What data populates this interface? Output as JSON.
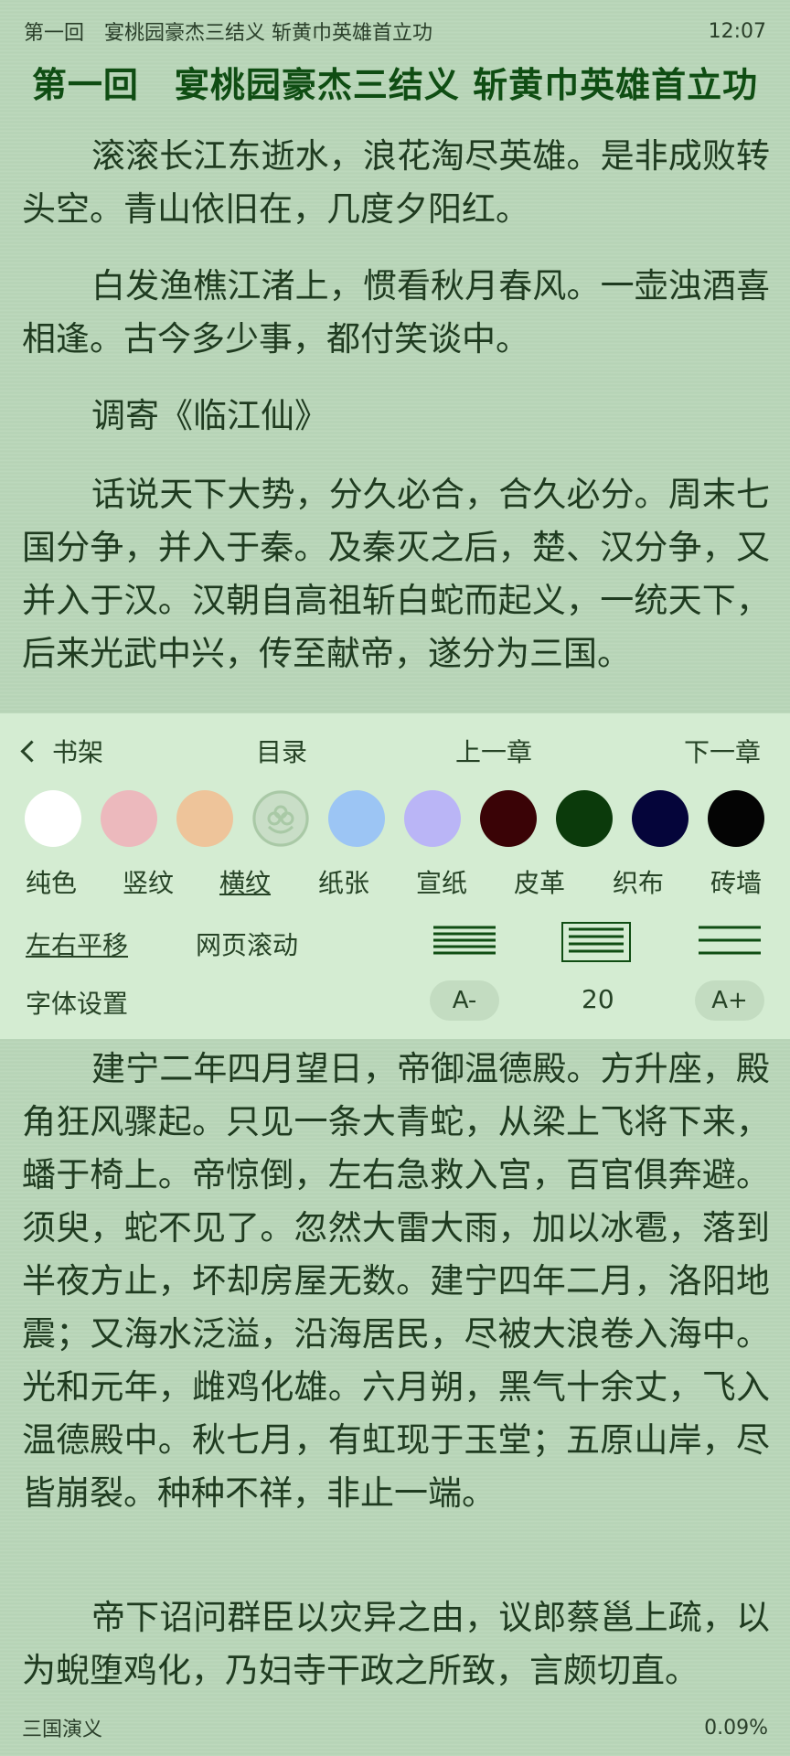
{
  "status_bar": {
    "chapter": "第一回　宴桃园豪杰三结义 斩黄巾英雄首立功",
    "time": "12:07"
  },
  "content": {
    "title": "第一回　宴桃园豪杰三结义 斩黄巾英雄首立功",
    "paragraphs_above": [
      "滚滚长江东逝水，浪花淘尽英雄。是非成败转头空。青山依旧在，几度夕阳红。",
      "白发渔樵江渚上，惯看秋月春风。一壶浊酒喜相逢。古今多少事，都付笑谈中。",
      "调寄《临江仙》",
      "话说天下大势，分久必合，合久必分。周末七国分争，并入于秦。及秦灭之后，楚、汉分争，又并入于汉。汉朝自高祖斩白蛇而起义，一统天下，后来光武中兴，传至献帝，遂分为三国。"
    ],
    "paragraphs_below": [
      "建宁二年四月望日，帝御温德殿。方升座，殿角狂风骤起。只见一条大青蛇，从梁上飞将下来，蟠于椅上。帝惊倒，左右急救入宫，百官俱奔避。须臾，蛇不见了。忽然大雷大雨，加以冰雹，落到半夜方止，坏却房屋无数。建宁四年二月，洛阳地震；又海水泛溢，沿海居民，尽被大浪卷入海中。光和元年，雌鸡化雄。六月朔，黑气十余丈，飞入温德殿中。秋七月，有虹现于玉堂；五原山岸，尽皆崩裂。种种不祥，非止一端。",
      "帝下诏问群臣以灾异之由，议郎蔡邕上疏，以为蜺堕鸡化，乃妇寺干政之所致，言颇切直。"
    ]
  },
  "panel": {
    "nav": {
      "back_label": "书架",
      "toc_label": "目录",
      "prev_label": "上一章",
      "next_label": "下一章"
    },
    "swatches": [
      {
        "name": "white",
        "color": "#ffffff"
      },
      {
        "name": "pink",
        "color": "#ecb9bd"
      },
      {
        "name": "peach",
        "color": "#eec49a"
      },
      {
        "name": "texture",
        "color": "#c9dec7"
      },
      {
        "name": "light-blue",
        "color": "#9cc5f4"
      },
      {
        "name": "lavender",
        "color": "#bab5f6"
      },
      {
        "name": "dark-red",
        "color": "#3a0306"
      },
      {
        "name": "dark-green",
        "color": "#0b3a0b"
      },
      {
        "name": "navy",
        "color": "#05053a"
      },
      {
        "name": "black",
        "color": "#040404"
      }
    ],
    "backgrounds": [
      "纯色",
      "竖纹",
      "横纹",
      "纸张",
      "宣纸",
      "皮革",
      "织布",
      "砖墙"
    ],
    "selected_background": "横纹",
    "page_modes": [
      "左右平移",
      "网页滚动"
    ],
    "selected_page_mode": "左右平移",
    "line_spacing_options": [
      "compact",
      "normal",
      "loose"
    ],
    "selected_line_spacing": "normal",
    "font_settings_label": "字体设置",
    "font_decrease": "A-",
    "font_size": "20",
    "font_increase": "A+",
    "accent_color": "#0f4d13"
  },
  "footer": {
    "book_title": "三国演义",
    "progress": "0.09%"
  }
}
